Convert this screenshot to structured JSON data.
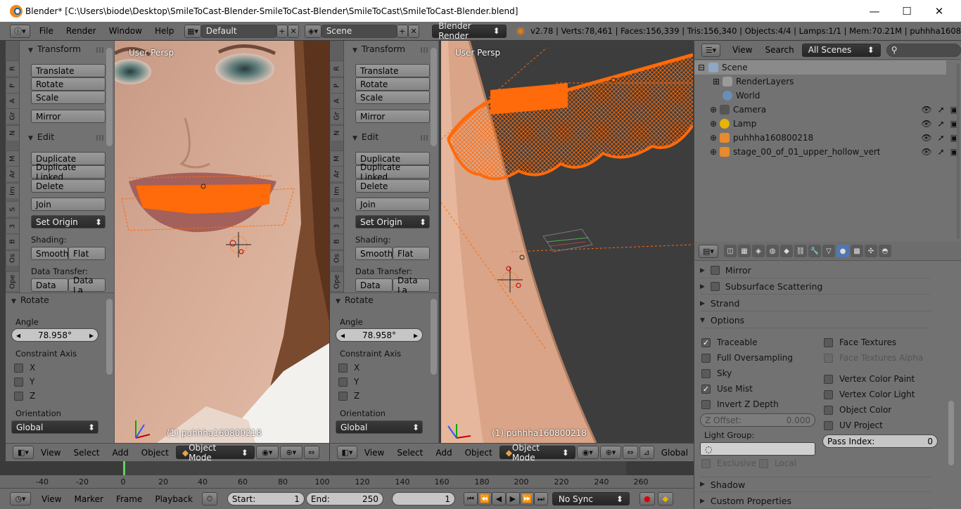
{
  "window": {
    "title": "Blender* [C:\\Users\\biode\\Desktop\\SmileToCast-Blender-SmileToCast-Blender\\SmileToCast\\SmileToCast-Blender.blend]",
    "minimize": "—",
    "maximize": "☐",
    "close": "✕"
  },
  "infobar": {
    "menus": [
      "File",
      "Render",
      "Window",
      "Help"
    ],
    "layout": "Default",
    "scene": "Scene",
    "engine": "Blender Render",
    "stats": "v2.78 | Verts:78,461 | Faces:156,339 | Tris:156,340 | Objects:4/4 | Lamps:1/1 | Mem:70.21M | puhhha1608"
  },
  "toolshelf": {
    "tabs": [
      "R",
      "P",
      "A",
      "Gr",
      "N",
      "M",
      "Ar",
      "Im",
      "S",
      "3",
      "B",
      "Os",
      "Ope"
    ],
    "transform_header": "Transform",
    "translate": "Translate",
    "rotate": "Rotate",
    "scale": "Scale",
    "mirror": "Mirror",
    "edit_header": "Edit",
    "duplicate": "Duplicate",
    "duplicate_linked": "Duplicate Linked",
    "delete": "Delete",
    "join": "Join",
    "set_origin": "Set Origin",
    "shading_label": "Shading:",
    "smooth": "Smooth",
    "flat": "Flat",
    "data_transfer_label": "Data Transfer:",
    "data": "Data",
    "data_la": "Data La",
    "rotate_panel_header": "Rotate",
    "angle_label": "Angle",
    "angle_value": "78.958°",
    "constraint_label": "Constraint Axis",
    "axis_x": "X",
    "axis_y": "Y",
    "axis_z": "Z",
    "orientation_label": "Orientation",
    "orientation_value": "Global"
  },
  "viewport_left": {
    "label": "User Persp",
    "object": "(1) puhhha160800218"
  },
  "viewport_right": {
    "label": "User Persp",
    "object": "(1) puhhha160800218"
  },
  "view_header": {
    "menus": [
      "View",
      "Select",
      "Add",
      "Object"
    ],
    "mode": "Object Mode",
    "orientation": "Global"
  },
  "timeline": {
    "ticks": [
      "-40",
      "-20",
      "0",
      "20",
      "40",
      "60",
      "80",
      "100",
      "120",
      "140",
      "160",
      "180",
      "200",
      "220",
      "240",
      "260"
    ],
    "menus": [
      "View",
      "Marker",
      "Frame",
      "Playback"
    ],
    "start_label": "Start:",
    "start_value": "1",
    "end_label": "End:",
    "end_value": "250",
    "current_frame": "1",
    "sync": "No Sync"
  },
  "outliner": {
    "menus": [
      "View",
      "Search"
    ],
    "scenes_dropdown": "All Scenes",
    "items": [
      "Scene",
      "RenderLayers",
      "World",
      "Camera",
      "Lamp",
      "puhhha160800218",
      "stage_00_of_01_upper_hollow_vert"
    ]
  },
  "properties": {
    "sections": {
      "mirror": "Mirror",
      "subsurface": "Subsurface Scattering",
      "strand": "Strand",
      "options": "Options",
      "shadow": "Shadow",
      "custom": "Custom Properties"
    },
    "options": {
      "traceable": "Traceable",
      "full_oversampling": "Full Oversampling",
      "sky": "Sky",
      "use_mist": "Use Mist",
      "invert_z": "Invert Z Depth",
      "z_offset_label": "Z Offset:",
      "z_offset_value": "0.000",
      "light_group": "Light Group:",
      "exclusive": "Exclusive",
      "local": "Local",
      "face_textures": "Face Textures",
      "face_textures_alpha": "Face Textures Alpha",
      "vertex_color_paint": "Vertex Color Paint",
      "vertex_color_light": "Vertex Color Light",
      "object_color": "Object Color",
      "uv_project": "UV Project",
      "pass_index_label": "Pass Index:",
      "pass_index_value": "0"
    }
  },
  "colors": {
    "selection_orange": "#ff6a0a",
    "panel_gray": "#727272",
    "header_gray": "#6d6d6d",
    "viewport_dark": "#3d3d3d"
  }
}
